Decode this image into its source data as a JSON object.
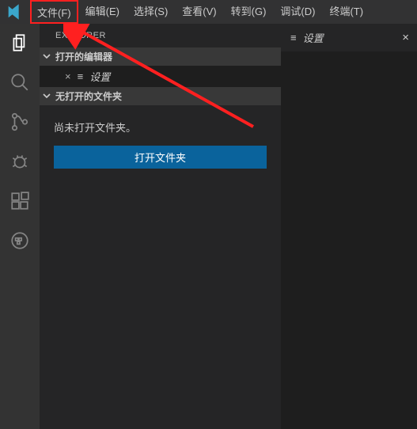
{
  "menu": {
    "file": "文件(F)",
    "edit": "编辑(E)",
    "selection": "选择(S)",
    "view": "查看(V)",
    "go": "转到(G)",
    "debug": "调试(D)",
    "terminal": "终端(T)"
  },
  "sidebar": {
    "title": "EXPLORER",
    "openEditors": "打开的编辑器",
    "noFolderOpened": "无打开的文件夹",
    "openItem": "设置",
    "noFolderMsg": "尚未打开文件夹。",
    "openFolderBtn": "打开文件夹"
  },
  "editor": {
    "tabLabel": "设置"
  },
  "icons": {
    "gear": "≡",
    "close": "×"
  }
}
